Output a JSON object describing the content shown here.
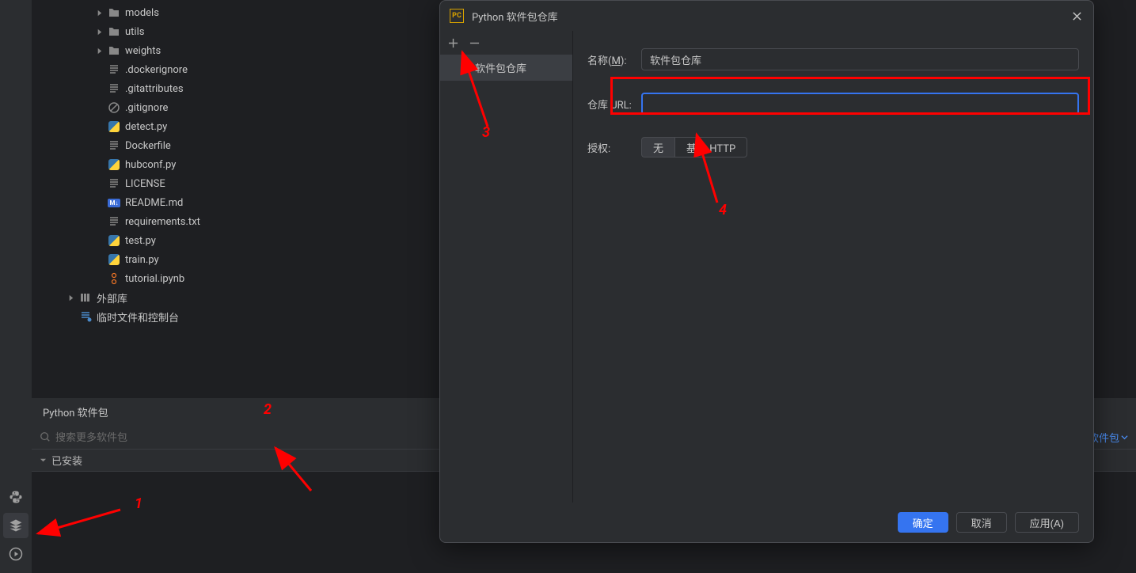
{
  "tree": {
    "models": "models",
    "utils": "utils",
    "weights": "weights",
    "dockerignore": ".dockerignore",
    "gitattributes": ".gitattributes",
    "gitignore": ".gitignore",
    "detect": "detect.py",
    "dockerfile": "Dockerfile",
    "hubconf": "hubconf.py",
    "license": "LICENSE",
    "readme": "README.md",
    "requirements": "requirements.txt",
    "test": "test.py",
    "train": "train.py",
    "tutorial": "tutorial.ipynb",
    "external": "外部库",
    "scratches": "临时文件和控制台"
  },
  "panel": {
    "title": "Python 软件包",
    "searchPlaceholder": "搜索更多软件包",
    "addPackage": "添加软件包",
    "installed": "已安装"
  },
  "dialog": {
    "iconText": "PC",
    "title": "Python 软件包仓库",
    "nameLabelPre": "名称(",
    "nameLabelM": "M",
    "nameLabelPost": "):",
    "nameValue": "软件包仓库",
    "urlLabel": "仓库 URL:",
    "authLabel": "授权:",
    "authNone": "无",
    "authBasic": "基本 HTTP",
    "repoItem": "软件包仓库",
    "ok": "确定",
    "cancel": "取消",
    "apply": "应用(A)"
  },
  "annotations": {
    "n1": "1",
    "n2": "2",
    "n3": "3",
    "n4": "4"
  }
}
